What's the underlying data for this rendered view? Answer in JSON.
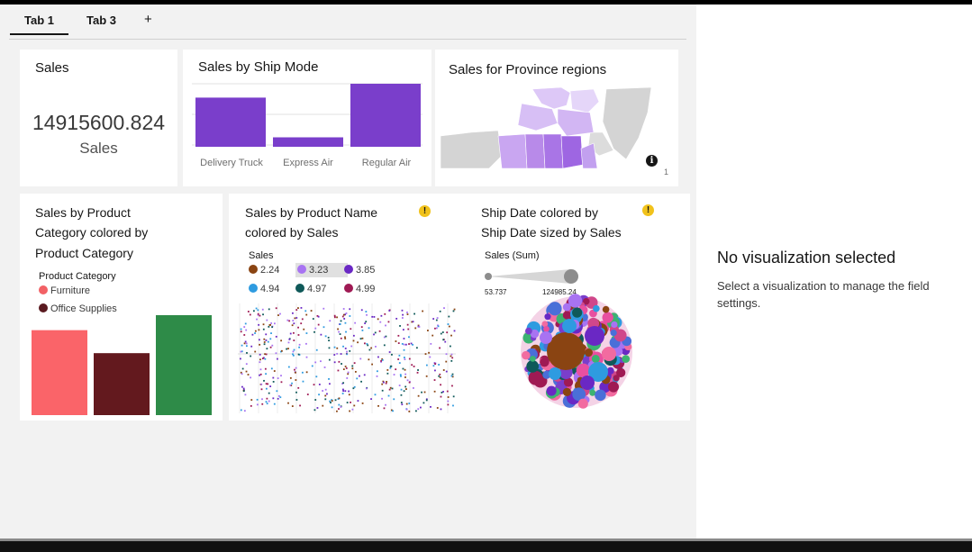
{
  "tabs": [
    {
      "label": "Tab 1",
      "active": true
    },
    {
      "label": "Tab 3",
      "active": false
    }
  ],
  "add_tab_label": "+",
  "cards": {
    "sales_kpi": {
      "title": "Sales",
      "value": "14915600.824",
      "label": "Sales"
    },
    "ship_mode": {
      "title": "Sales by Ship Mode",
      "chart_data": {
        "type": "bar",
        "categories": [
          "Delivery Truck",
          "Express Air",
          "Regular Air"
        ],
        "values": [
          0.78,
          0.15,
          1.0
        ],
        "color": "#7a3ecb"
      }
    },
    "province_map": {
      "title": "Sales for Province regions",
      "info_icon": "i",
      "scale_mark": "1"
    },
    "product_category": {
      "title_lines": [
        "Sales by Product",
        "Category colored by",
        "Product Category"
      ],
      "legend_title": "Product Category",
      "legend": [
        {
          "label": "Furniture",
          "color": "#f26165"
        },
        {
          "label": "Office Supplies",
          "color": "#5a1a20"
        }
      ],
      "chart_data": {
        "type": "bar",
        "values": [
          0.85,
          0.62,
          1.0
        ],
        "colors": [
          "#fa6469",
          "#63191e",
          "#2e8b48"
        ]
      }
    },
    "product_name": {
      "title_lines": [
        "Sales by Product Name",
        "colored by Sales"
      ],
      "warning": "!",
      "legend_title": "Sales",
      "legend": [
        {
          "label": "2.24",
          "color": "#8a4412"
        },
        {
          "label": "3.23",
          "color": "#a873f2",
          "highlight": true
        },
        {
          "label": "3.85",
          "color": "#6a28c4"
        },
        {
          "label": "4.94",
          "color": "#2e9be0"
        },
        {
          "label": "4.97",
          "color": "#0f5959"
        },
        {
          "label": "4.99",
          "color": "#9f1a54"
        }
      ]
    },
    "ship_date": {
      "title_lines": [
        "Ship Date colored by",
        "Ship Date sized by Sales"
      ],
      "warning": "!",
      "slider_title": "Sales (Sum)",
      "slider_min": "53.737",
      "slider_max": "124985.24"
    }
  },
  "right_panel": {
    "title": "No visualization selected",
    "description": "Select a visualization to manage the field settings."
  },
  "colors": {
    "purple": "#7a3ecb",
    "canvas": "#f2f2f2",
    "warning": "#f1c21b"
  }
}
